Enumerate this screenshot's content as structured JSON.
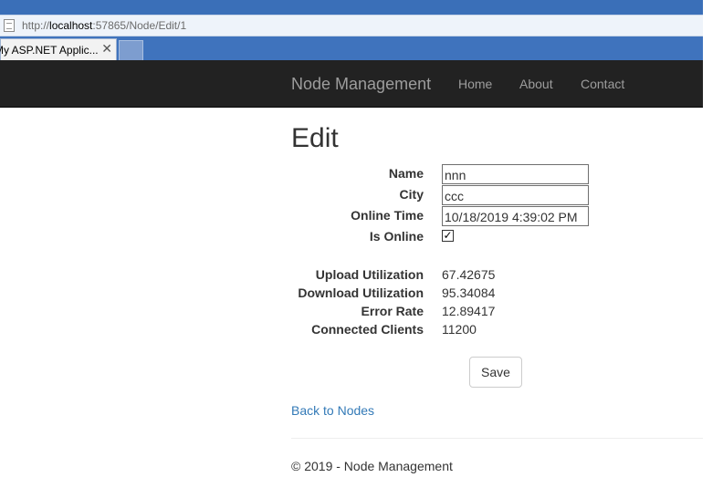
{
  "browser": {
    "url_prefix": "http://",
    "url_host": "localhost",
    "url_rest": ":57865/Node/Edit/1",
    "tab_title": "My ASP.NET Applic...",
    "tab_close": "✕"
  },
  "navbar": {
    "brand": "Node Management",
    "links": [
      "Home",
      "About",
      "Contact"
    ]
  },
  "page": {
    "title": "Edit"
  },
  "form": {
    "name_label": "Name",
    "name_value": "nnn",
    "city_label": "City",
    "city_value": "ccc",
    "online_time_label": "Online Time",
    "online_time_value": "10/18/2019 4:39:02 PM",
    "is_online_label": "Is Online",
    "is_online_checked": true,
    "checkmark": "✓"
  },
  "stats": {
    "upload_label": "Upload Utilization",
    "upload_value": "67.42675",
    "download_label": "Download Utilization",
    "download_value": "95.34084",
    "error_label": "Error Rate",
    "error_value": "12.89417",
    "clients_label": "Connected Clients",
    "clients_value": "11200"
  },
  "actions": {
    "save_label": "Save",
    "back_label": "Back to Nodes"
  },
  "footer": {
    "text": "© 2019 - Node Management"
  }
}
